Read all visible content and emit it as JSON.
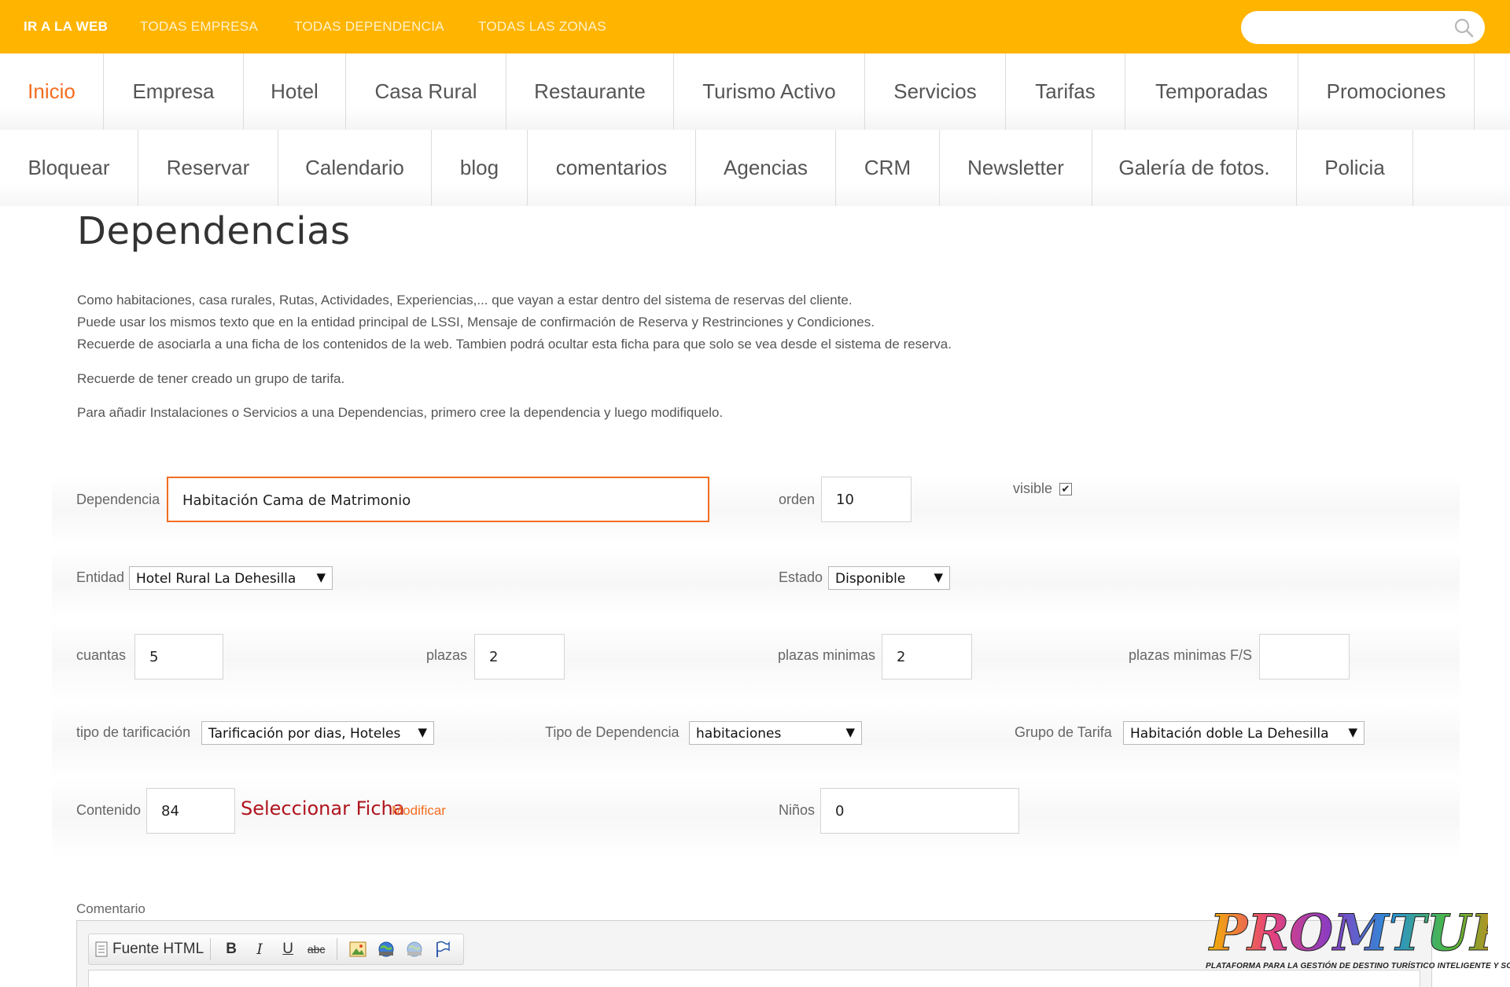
{
  "topbar": {
    "links": [
      "IR A LA WEB",
      "TODAS EMPRESA",
      "TODAS DEPENDENCIA",
      "TODAS LAS ZONAS"
    ],
    "search_value": "",
    "search_placeholder": ""
  },
  "nav": {
    "row1": [
      "Inicio",
      "Empresa",
      "Hotel",
      "Casa Rural",
      "Restaurante",
      "Turismo Activo",
      "Servicios",
      "Tarifas",
      "Temporadas",
      "Promociones"
    ],
    "row2": [
      "Bloquear",
      "Reservar",
      "Calendario",
      "blog",
      "comentarios",
      "Agencias",
      "CRM",
      "Newsletter",
      "Galería de fotos.",
      "Policia"
    ],
    "active": "Inicio"
  },
  "page": {
    "title": "Dependencias",
    "desc": [
      "Como habitaciones, casa rurales, Rutas, Actividades, Experiencias,... que vayan a estar dentro del sistema de reservas del cliente.",
      "Puede usar los mismos texto que en la entidad principal de LSSI, Mensaje de confirmación de Reserva y Restrinciones y Condiciones.",
      "Recuerde de asociarla a una ficha de los contenidos de la web. Tambien podrá ocultar esta ficha para que solo se vea desde el sistema de reserva.",
      "Recuerde de tener creado un grupo de tarifa.",
      "Para añadir Instalaciones o Servicios a una Dependencias, primero cree la dependencia y luego modifiquelo."
    ]
  },
  "form": {
    "dependencia": {
      "label": "Dependencia",
      "value": "Habitación Cama de Matrimonio"
    },
    "orden": {
      "label": "orden",
      "value": "10"
    },
    "visible": {
      "label": "visible",
      "checked": true
    },
    "entidad": {
      "label": "Entidad",
      "value": "Hotel Rural La Dehesilla"
    },
    "estado": {
      "label": "Estado",
      "value": "Disponible"
    },
    "cuantas": {
      "label": "cuantas",
      "value": "5"
    },
    "plazas": {
      "label": "plazas",
      "value": "2"
    },
    "plazas_minimas": {
      "label": "plazas minimas",
      "value": "2"
    },
    "plazas_minimas_fs": {
      "label": "plazas minimas F/S",
      "value": ""
    },
    "tipo_tarificacion": {
      "label": "tipo de tarificación",
      "value": "Tarificación por dias, Hoteles"
    },
    "tipo_dependencia": {
      "label": "Tipo de Dependencia",
      "value": "habitaciones"
    },
    "grupo_tarifa": {
      "label": "Grupo de Tarifa",
      "value": "Habitación doble La Dehesilla"
    },
    "contenido": {
      "label": "Contenido",
      "value": "84",
      "select_link": "Seleccionar Ficha",
      "modify_link": "Modificar"
    },
    "ninos": {
      "label": "Niños",
      "value": "0"
    },
    "comentario": {
      "label": "Comentario"
    }
  },
  "editor": {
    "source_label": "Fuente HTML",
    "bold": "B",
    "italic": "I",
    "underline": "U",
    "strike": "abc"
  },
  "logo": {
    "text": "PROMTUR",
    "subtitle": "PLATAFORMA PARA LA GESTIÓN DE DESTINO TURÍSTICO INTELIGENTE Y SOSTENIBLE"
  }
}
